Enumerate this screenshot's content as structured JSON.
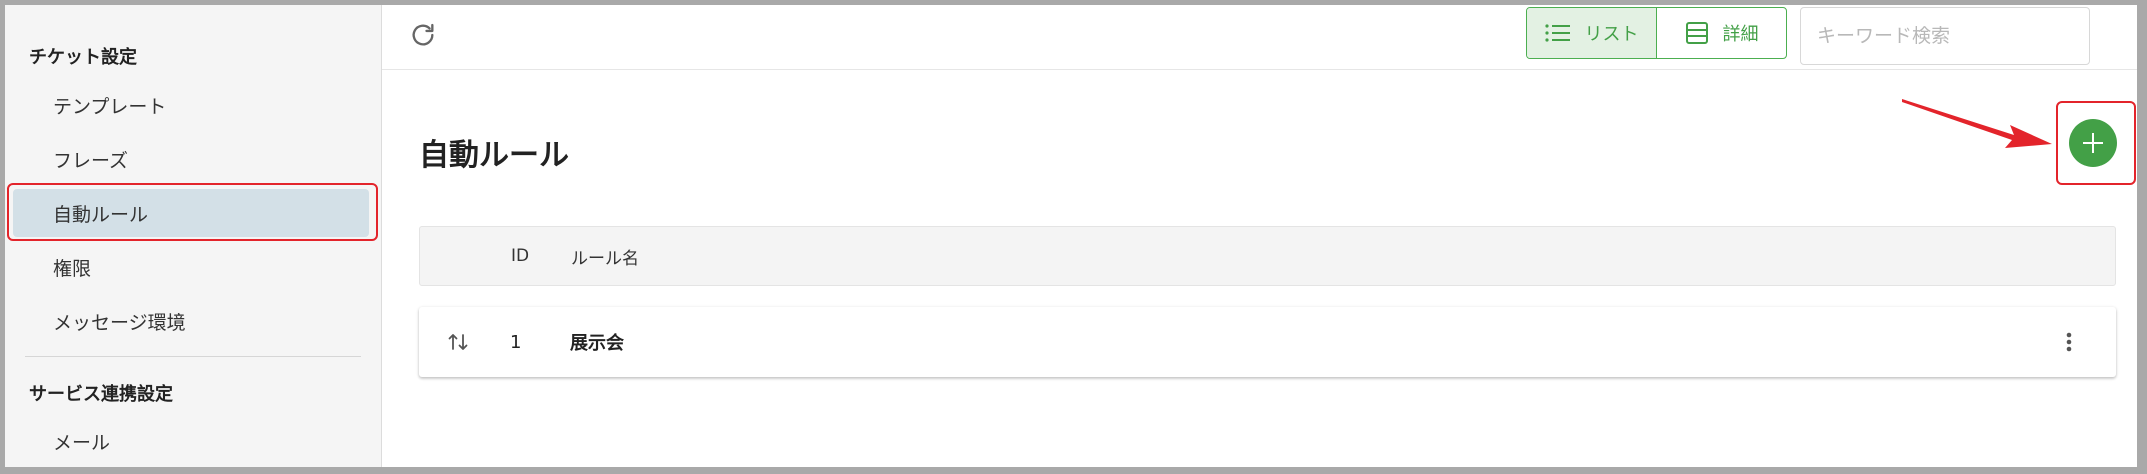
{
  "sidebar": {
    "sections": [
      {
        "title": "チケット設定"
      },
      {
        "title": "サービス連携設定"
      }
    ],
    "items": [
      {
        "label": "テンプレート"
      },
      {
        "label": "フレーズ"
      },
      {
        "label": "自動ルール"
      },
      {
        "label": "権限"
      },
      {
        "label": "メッセージ環境"
      },
      {
        "label": "メール"
      }
    ]
  },
  "toolbar": {
    "refresh_icon": "refresh-icon",
    "view_list_label": "リスト",
    "view_detail_label": "詳細",
    "search_placeholder": "キーワード検索",
    "search_value": ""
  },
  "main": {
    "title": "自動ルール",
    "add_icon": "plus-icon",
    "table": {
      "columns": [
        "",
        "ID",
        "ルール名",
        ""
      ],
      "rows": [
        {
          "id": "1",
          "name": "展示会"
        }
      ]
    }
  },
  "colors": {
    "accent_green": "#43a047",
    "highlight_red": "#e3242b",
    "sidebar_active": "#d3e0e7"
  }
}
